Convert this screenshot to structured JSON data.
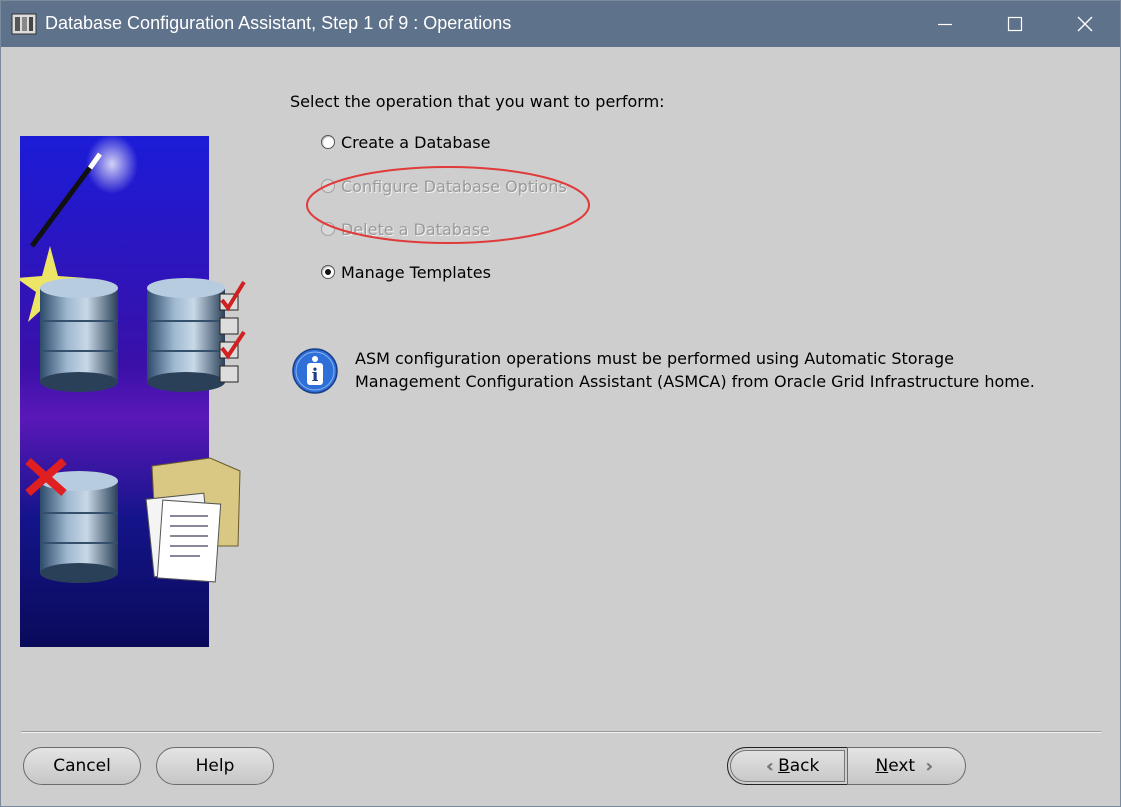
{
  "window": {
    "title": "Database Configuration Assistant, Step 1 of 9 : Operations",
    "titlebar_color": "#5f728b",
    "background_color": "#cecece"
  },
  "titlebar_buttons": {
    "minimize_icon": "minimize-icon",
    "maximize_icon": "maximize-icon",
    "close_icon": "close-icon"
  },
  "operations": {
    "prompt": "Select the operation that you want to perform:",
    "options": [
      {
        "label": "Create a Database",
        "checked": false,
        "enabled": true
      },
      {
        "label": "Configure Database Options",
        "checked": false,
        "enabled": false
      },
      {
        "label": "Delete a Database",
        "checked": false,
        "enabled": false
      },
      {
        "label": "Manage Templates",
        "checked": true,
        "enabled": true
      }
    ]
  },
  "annotation": {
    "color": "#e03a3a"
  },
  "info": {
    "icon": "info-icon",
    "line1": "ASM configuration operations must be performed using Automatic Storage",
    "line2": "Management Configuration Assistant (ASMCA) from Oracle Grid Infrastructure home."
  },
  "footer": {
    "cancel_label": "Cancel",
    "help_label": "Help",
    "back_label": "Back",
    "back_mnemonic": "B",
    "back_rest": "ack",
    "next_label": "Next",
    "next_mnemonic": "N",
    "next_rest": "ext"
  }
}
